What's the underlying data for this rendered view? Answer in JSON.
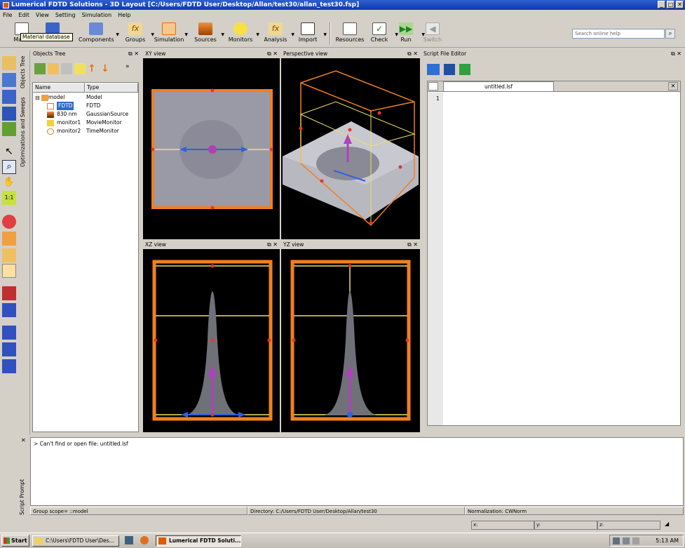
{
  "window": {
    "title": "Lumerical FDTD Solutions - 3D Layout [C:/Users/FDTD User/Desktop/Allan/test30/allan_test30.fsp]"
  },
  "menu": [
    "File",
    "Edit",
    "View",
    "Setting",
    "Simulation",
    "Help"
  ],
  "toolbar": {
    "buttons": [
      {
        "label": "Mater"
      },
      {
        "label": ""
      },
      {
        "label": "Components"
      },
      {
        "label": "Groups"
      },
      {
        "label": "Simulation"
      },
      {
        "label": "Sources"
      },
      {
        "label": "Monitors"
      },
      {
        "label": "Analysis"
      },
      {
        "label": "Import"
      },
      {
        "label": "Resources"
      },
      {
        "label": "Check"
      },
      {
        "label": "Run"
      },
      {
        "label": "Switch"
      }
    ],
    "tooltip": "Material database",
    "search_placeholder": "Search online help"
  },
  "side_tabs": {
    "objects": "Objects Tree",
    "optimizations": "Optimizations and Sweeps",
    "script_prompt": "Script Prompt"
  },
  "objects_tree": {
    "title": "Objects Tree",
    "columns": [
      "Name",
      "Type"
    ],
    "rows": [
      {
        "name": "model",
        "type": "Model"
      },
      {
        "name": "FDTD",
        "type": "FDTD"
      },
      {
        "name": "830 nm",
        "type": "GaussianSource"
      },
      {
        "name": "monitor1",
        "type": "MovieMonitor"
      },
      {
        "name": "monitor2",
        "type": "TimeMonitor"
      }
    ]
  },
  "views": {
    "xy": "XY view",
    "perspective": "Perspective view",
    "xz": "XZ view",
    "yz": "YZ view"
  },
  "script_editor": {
    "title": "Script File Editor",
    "tab": "untitled.lsf",
    "line": "1"
  },
  "console": {
    "message": "> Can't find or open file: untitled.lsf"
  },
  "status": {
    "group_scope": "Group scope= ::model",
    "directory": "Directory: C:/Users/FDTD User/Desktop/Allan/test30",
    "normalization": "Normalization: CWNorm"
  },
  "coords": {
    "x": "x:",
    "y": "y:",
    "z": "z:"
  },
  "taskbar": {
    "start": "Start",
    "tasks": [
      "C:\\Users\\FDTD User\\Des...",
      "Lumerical FDTD Soluti..."
    ],
    "time": "5:13 AM"
  }
}
